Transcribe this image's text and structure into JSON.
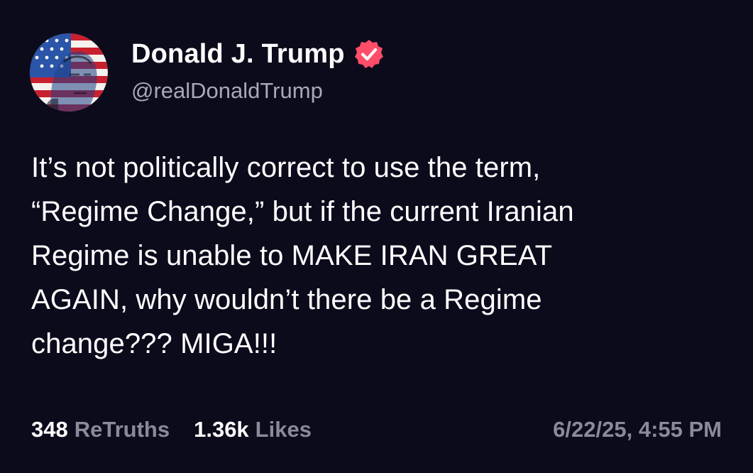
{
  "author": {
    "display_name": "Donald J. Trump",
    "handle": "@realDonaldTrump",
    "avatar_icon": "flag-portrait-avatar",
    "verified_icon": "verified-badge-icon",
    "verified_color": "#ff4d6a"
  },
  "post": {
    "text": "It’s not politically correct to use the term,\n“Regime Change,” but if the current Iranian\nRegime is unable to MAKE IRAN GREAT\nAGAIN, why wouldn’t there be a Regime\nchange??? MIGA!!!"
  },
  "stats": {
    "retruths_count": "348",
    "retruths_label": "ReTruths",
    "likes_count": "1.36k",
    "likes_label": "Likes"
  },
  "timestamp": "6/22/25, 4:55 PM",
  "colors": {
    "background": "#0c0b1c",
    "primary_text": "#ffffff",
    "secondary_text": "#8a8a9c"
  }
}
